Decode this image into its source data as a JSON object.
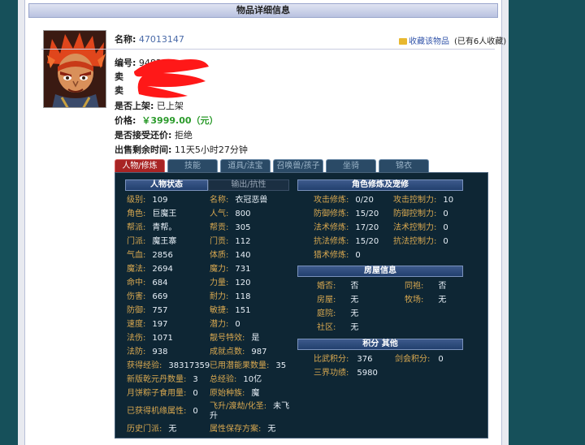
{
  "title": "物品详细信息",
  "item": {
    "name_label": "名称:",
    "name_value": "47013147",
    "id_label": "编号:",
    "id_value": "94833",
    "seller_label": "卖",
    "server_label": "卖",
    "on_shelf_label": "是否上架:",
    "on_shelf_value": "已上架",
    "price_label": "价格:",
    "price_value": "￥3999.00（元）",
    "bargain_label": "是否接受还价:",
    "bargain_value": "拒绝",
    "time_left_label": "出售剩余时间:",
    "time_left_value": "11天5小时27分钟"
  },
  "collect": {
    "label": "收藏该物品",
    "count": "(已有6人收藏)"
  },
  "tabs": [
    "人物/修炼",
    "技能",
    "道具/法宝",
    "召唤兽/孩子",
    "坐骑",
    "锦衣"
  ],
  "char_status": {
    "header": "人物状态",
    "header2": "输出/抗性",
    "left": [
      [
        "级别:",
        "109"
      ],
      [
        "角色:",
        "巨魔王"
      ],
      [
        "帮派:",
        "青帮。"
      ],
      [
        "门派:",
        "魔王寨"
      ],
      [
        "气血:",
        "2856"
      ],
      [
        "魔法:",
        "2694"
      ],
      [
        "命中:",
        "684"
      ],
      [
        "伤害:",
        "669"
      ],
      [
        "防御:",
        "757"
      ],
      [
        "速度:",
        "197"
      ],
      [
        "法伤:",
        "1071"
      ],
      [
        "法防:",
        "938"
      ],
      [
        "获得经验:",
        "38317359"
      ],
      [
        "新版乾元丹数量:",
        "3"
      ],
      [
        "月饼粽子食用量:",
        "0"
      ],
      [
        "已获得机缘属性:",
        "0"
      ],
      [
        "历史门派:",
        "无"
      ]
    ],
    "right": [
      [
        "名称:",
        "衣冠恶兽"
      ],
      [
        "人气:",
        "800"
      ],
      [
        "帮贡:",
        "305"
      ],
      [
        "门贡:",
        "112"
      ],
      [
        "体质:",
        "140"
      ],
      [
        "魔力:",
        "731"
      ],
      [
        "力量:",
        "120"
      ],
      [
        "耐力:",
        "118"
      ],
      [
        "敏捷:",
        "151"
      ],
      [
        "潜力:",
        "0"
      ],
      [
        "靓号特效:",
        "是"
      ],
      [
        "成就点数:",
        "987"
      ],
      [
        "已用潜能果数量:",
        "35"
      ],
      [
        "总经验:",
        "10亿"
      ],
      [
        "原始种族:",
        "魔"
      ],
      [
        "飞升/渡劫/化圣:",
        "未飞升"
      ],
      [
        "属性保存方案:",
        "无"
      ]
    ]
  },
  "cultivation": {
    "header": "角色修炼及宠修",
    "rows": [
      [
        "攻击修炼:",
        "0/20",
        "攻击控制力:",
        "10"
      ],
      [
        "防御修炼:",
        "15/20",
        "防御控制力:",
        "0"
      ],
      [
        "法术修炼:",
        "17/20",
        "法术控制力:",
        "0"
      ],
      [
        "抗法修炼:",
        "15/20",
        "抗法控制力:",
        "0"
      ],
      [
        "猎术修炼:",
        "0",
        "",
        ""
      ]
    ]
  },
  "house": {
    "header": "房屋信息",
    "rows": [
      [
        "婚否:",
        "否",
        "同袍:",
        "否"
      ],
      [
        "房屋:",
        "无",
        "牧场:",
        "无"
      ],
      [
        "庭院:",
        "无",
        "",
        ""
      ],
      [
        "社区:",
        "无",
        "",
        ""
      ]
    ]
  },
  "points": {
    "header": "积分 其他",
    "rows": [
      [
        "比武积分:",
        "376",
        "剑会积分:",
        "0"
      ],
      [
        "三界功绩:",
        "5980",
        "",
        ""
      ]
    ]
  }
}
